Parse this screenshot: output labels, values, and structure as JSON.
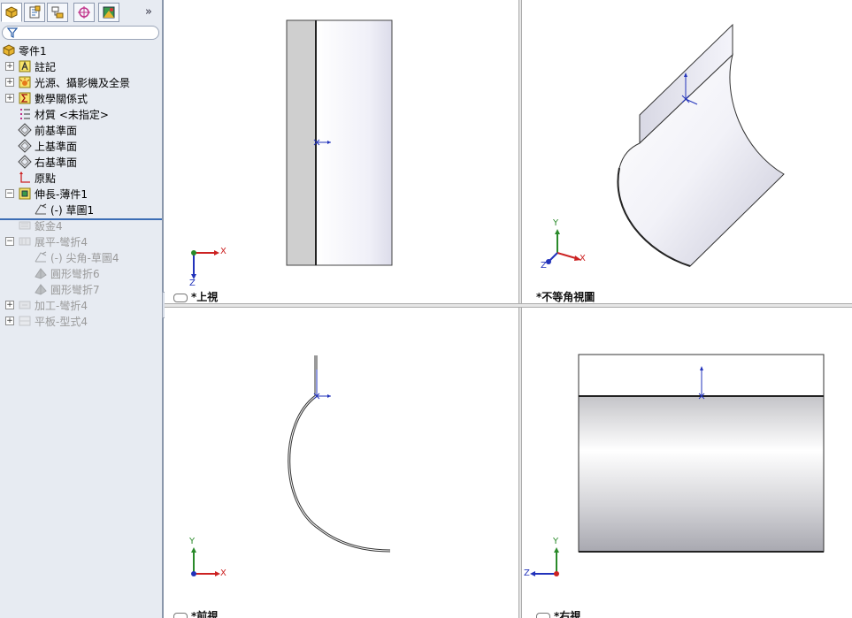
{
  "feature_manager": {
    "expand_glyph": "»",
    "tabs": [
      "feature-manager-tab",
      "property-manager-tab",
      "configuration-manager-tab",
      "dimxpert-tab",
      "display-manager-tab"
    ],
    "tree": [
      {
        "label": "零件1",
        "icon": "part-icon",
        "level": 0,
        "expander": "",
        "dim": false
      },
      {
        "label": "註記",
        "icon": "annotations-icon",
        "level": 1,
        "expander": "+",
        "dim": false
      },
      {
        "label": "光源、攝影機及全景",
        "icon": "lights-cameras-icon",
        "level": 1,
        "expander": "+",
        "dim": false
      },
      {
        "label": "數學關係式",
        "icon": "equations-icon",
        "level": 1,
        "expander": "+",
        "dim": false
      },
      {
        "label": "材質 <未指定>",
        "icon": "material-icon",
        "level": 1,
        "expander": "",
        "dim": false
      },
      {
        "label": "前基準面",
        "icon": "plane-icon",
        "level": 1,
        "expander": "",
        "dim": false
      },
      {
        "label": "上基準面",
        "icon": "plane-icon",
        "level": 1,
        "expander": "",
        "dim": false
      },
      {
        "label": "右基準面",
        "icon": "plane-icon",
        "level": 1,
        "expander": "",
        "dim": false
      },
      {
        "label": "原點",
        "icon": "origin-icon",
        "level": 1,
        "expander": "",
        "dim": false
      },
      {
        "label": "伸長-薄件1",
        "icon": "base-flange-icon",
        "level": 1,
        "expander": "−",
        "dim": false
      },
      {
        "label": "(-) 草圖1",
        "icon": "sketch-icon",
        "level": 2,
        "expander": "",
        "dim": false
      },
      {
        "label": "鈑金4",
        "icon": "sheet-metal-icon",
        "level": 1,
        "expander": "",
        "dim": true
      },
      {
        "label": "展平-彎折4",
        "icon": "flatten-bends-icon",
        "level": 1,
        "expander": "−",
        "dim": true
      },
      {
        "label": "(-) 尖角-草圖4",
        "icon": "sketch-icon",
        "level": 2,
        "expander": "",
        "dim": true
      },
      {
        "label": "圓形彎折6",
        "icon": "bend-icon",
        "level": 2,
        "expander": "",
        "dim": true
      },
      {
        "label": "圓形彎折7",
        "icon": "bend-icon",
        "level": 2,
        "expander": "",
        "dim": true
      },
      {
        "label": "加工-彎折4",
        "icon": "process-bends-icon",
        "level": 1,
        "expander": "+",
        "dim": true
      },
      {
        "label": "平板-型式4",
        "icon": "flat-pattern-icon",
        "level": 1,
        "expander": "+",
        "dim": true
      }
    ]
  },
  "viewports": {
    "top": {
      "label": "*上視",
      "axes": {
        "x": "X",
        "z": "Z"
      }
    },
    "iso": {
      "label": "*不等角視圖",
      "axes": {
        "x": "X",
        "y": "Y",
        "z": "Z"
      }
    },
    "front": {
      "label": "*前視",
      "axes": {
        "x": "X",
        "y": "Y"
      }
    },
    "right": {
      "label": "*右視",
      "axes": {
        "y": "Y",
        "z": "Z"
      }
    }
  },
  "colors": {
    "panel_bg": "#e7ebf2",
    "axis_x": "#cc2222",
    "axis_y": "#2a8a2a",
    "axis_z": "#2233bb",
    "rollback_bar": "#3c6db5"
  }
}
